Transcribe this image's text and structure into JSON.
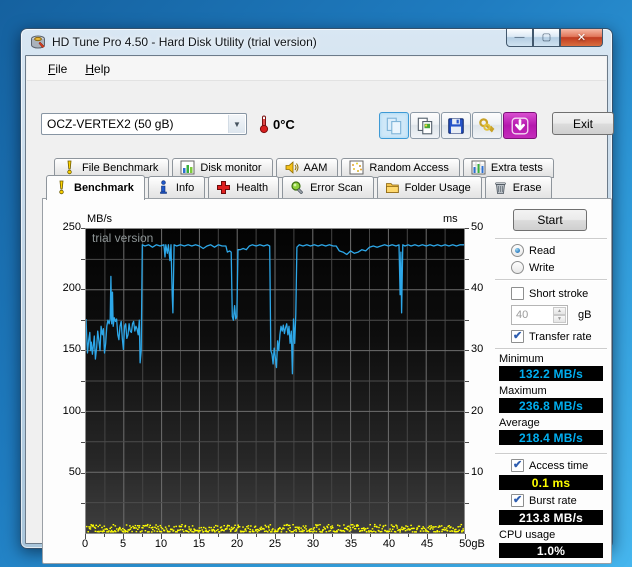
{
  "window": {
    "title": "HD Tune Pro 4.50 - Hard Disk Utility (trial version)",
    "controls": {
      "minimize": "—",
      "maximize": "▢",
      "close": "✕"
    }
  },
  "menu": {
    "items": [
      "File",
      "Help"
    ]
  },
  "toolbar": {
    "drive_select": "OCZ-VERTEX2 (50 gB)",
    "temperature": "0°C",
    "buttons": [
      {
        "icon": "copy-pages",
        "active": true
      },
      {
        "icon": "copy-screenshot",
        "active": false
      },
      {
        "icon": "save-screenshot",
        "active": false
      },
      {
        "icon": "license-keys",
        "active": false
      },
      {
        "icon": "download-arrow",
        "active": false,
        "accent": true
      }
    ],
    "exit_label": "Exit"
  },
  "tabs": {
    "row1": [
      {
        "label": "File Benchmark",
        "icon": "exclamation"
      },
      {
        "label": "Disk monitor",
        "icon": "bar-chart"
      },
      {
        "label": "AAM",
        "icon": "speaker"
      },
      {
        "label": "Random Access",
        "icon": "scatter"
      },
      {
        "label": "Extra tests",
        "icon": "chart-grid"
      }
    ],
    "row2": [
      {
        "label": "Benchmark",
        "icon": "exclamation",
        "active": true
      },
      {
        "label": "Info",
        "icon": "info"
      },
      {
        "label": "Health",
        "icon": "health-cross"
      },
      {
        "label": "Error Scan",
        "icon": "magnifier"
      },
      {
        "label": "Folder Usage",
        "icon": "folder"
      },
      {
        "label": "Erase",
        "icon": "trash"
      }
    ]
  },
  "panel": {
    "start_label": "Start",
    "mode": {
      "read_label": "Read",
      "write_label": "Write",
      "selected": "Read"
    },
    "short_stroke": {
      "label": "Short stroke",
      "checked": false,
      "value": "40",
      "unit": "gB"
    },
    "transfer_rate": {
      "label": "Transfer rate",
      "checked": true
    },
    "stats": {
      "minimum_label": "Minimum",
      "minimum": "132.2 MB/s",
      "maximum_label": "Maximum",
      "maximum": "236.8 MB/s",
      "average_label": "Average",
      "average": "218.4 MB/s"
    },
    "access_time": {
      "label": "Access time",
      "checked": true,
      "value": "0.1 ms"
    },
    "burst_rate": {
      "label": "Burst rate",
      "checked": true,
      "value": "213.8 MB/s"
    },
    "cpu_usage": {
      "label": "CPU usage",
      "value": "1.0%"
    }
  },
  "chart_data": {
    "type": "line",
    "watermark": "trial version",
    "left_axis": {
      "label": "MB/s",
      "min": 0,
      "max": 250,
      "ticks": [
        250,
        200,
        150,
        100,
        50
      ],
      "grid_step": 25
    },
    "right_axis": {
      "label": "ms",
      "min": 0,
      "max": 50,
      "ticks": [
        50,
        40,
        30,
        20,
        10
      ]
    },
    "x_axis": {
      "min": 0,
      "max": 50,
      "tick_labels": [
        "0",
        "5",
        "10",
        "15",
        "20",
        "25",
        "30",
        "35",
        "40",
        "45",
        "50gB"
      ],
      "tick_step": 5,
      "minor_step": 2.5
    },
    "series": [
      {
        "name": "transfer-rate",
        "axis": "left",
        "unit": "MB/s",
        "color": "#2da7e8",
        "style": "line",
        "points": [
          [
            0,
            176
          ],
          [
            0.1,
            160
          ],
          [
            0.2,
            148
          ],
          [
            0.35,
            158
          ],
          [
            0.5,
            165
          ],
          [
            0.6,
            150
          ],
          [
            0.7,
            157
          ],
          [
            0.85,
            147
          ],
          [
            1.0,
            156
          ],
          [
            1.1,
            162
          ],
          [
            1.25,
            143
          ],
          [
            1.4,
            152
          ],
          [
            1.55,
            166
          ],
          [
            1.7,
            158
          ],
          [
            1.85,
            150
          ],
          [
            2.0,
            170
          ],
          [
            2.15,
            163
          ],
          [
            2.3,
            168
          ],
          [
            2.45,
            148
          ],
          [
            2.6,
            156
          ],
          [
            2.75,
            170
          ],
          [
            2.9,
            175
          ],
          [
            3.05,
            172
          ],
          [
            3.2,
            176
          ],
          [
            3.3,
            211
          ],
          [
            3.4,
            172
          ],
          [
            3.5,
            198
          ],
          [
            3.6,
            170
          ],
          [
            3.75,
            177
          ],
          [
            3.9,
            174
          ],
          [
            4.05,
            176
          ],
          [
            4.2,
            163
          ],
          [
            4.35,
            159
          ],
          [
            4.5,
            170
          ],
          [
            4.65,
            174
          ],
          [
            4.8,
            160
          ],
          [
            4.95,
            151
          ],
          [
            5.1,
            170
          ],
          [
            5.25,
            172
          ],
          [
            5.4,
            160
          ],
          [
            5.55,
            163
          ],
          [
            5.7,
            172
          ],
          [
            5.85,
            166
          ],
          [
            6.0,
            165
          ],
          [
            6.15,
            172
          ],
          [
            6.3,
            174
          ],
          [
            6.45,
            166
          ],
          [
            6.6,
            170
          ],
          [
            6.75,
            168
          ],
          [
            6.9,
            163
          ],
          [
            7.05,
            175
          ],
          [
            7.15,
            140
          ],
          [
            7.3,
            150
          ],
          [
            7.45,
            237
          ],
          [
            7.8,
            236
          ],
          [
            8.3,
            237
          ],
          [
            8.8,
            235
          ],
          [
            9.3,
            237
          ],
          [
            9.8,
            236
          ],
          [
            10.3,
            237
          ],
          [
            10.45,
            227
          ],
          [
            10.55,
            237
          ],
          [
            10.75,
            230
          ],
          [
            10.9,
            237
          ],
          [
            11.1,
            224
          ],
          [
            11.25,
            237
          ],
          [
            11.4,
            196
          ],
          [
            11.5,
            181
          ],
          [
            11.65,
            237
          ],
          [
            12,
            236
          ],
          [
            12.5,
            237
          ],
          [
            13,
            236
          ],
          [
            13.5,
            237
          ],
          [
            14,
            236
          ],
          [
            14.5,
            237
          ],
          [
            15,
            236
          ],
          [
            15.5,
            234
          ],
          [
            16,
            236
          ],
          [
            16.5,
            237
          ],
          [
            17,
            235
          ],
          [
            17.5,
            237
          ],
          [
            18,
            236
          ],
          [
            18.5,
            236
          ],
          [
            18.7,
            231
          ],
          [
            19.0,
            232
          ],
          [
            19.2,
            231
          ],
          [
            19.35,
            178
          ],
          [
            19.5,
            175
          ],
          [
            19.65,
            187
          ],
          [
            19.8,
            176
          ],
          [
            19.95,
            178
          ],
          [
            20.1,
            233
          ],
          [
            20.4,
            233
          ],
          [
            20.8,
            234
          ],
          [
            21.2,
            233
          ],
          [
            21.6,
            236
          ],
          [
            22,
            237
          ],
          [
            22.5,
            236
          ],
          [
            23,
            237
          ],
          [
            23.5,
            236
          ],
          [
            24,
            237
          ],
          [
            24.3,
            236
          ],
          [
            24.45,
            150
          ],
          [
            24.6,
            147
          ],
          [
            24.75,
            139
          ],
          [
            24.9,
            152
          ],
          [
            25.05,
            144
          ],
          [
            25.2,
            136
          ],
          [
            25.35,
            158
          ],
          [
            25.5,
            150
          ],
          [
            25.65,
            163
          ],
          [
            25.8,
            170
          ],
          [
            25.95,
            166
          ],
          [
            26.1,
            171
          ],
          [
            26.25,
            164
          ],
          [
            26.4,
            169
          ],
          [
            26.55,
            172
          ],
          [
            26.7,
            163
          ],
          [
            26.85,
            170
          ],
          [
            27.0,
            156
          ],
          [
            27.15,
            166
          ],
          [
            27.3,
            131
          ],
          [
            27.45,
            176
          ],
          [
            27.6,
            156
          ],
          [
            27.75,
            180
          ],
          [
            27.9,
            235
          ],
          [
            28.2,
            237
          ],
          [
            28.7,
            236
          ],
          [
            29.2,
            237
          ],
          [
            29.7,
            236
          ],
          [
            30.2,
            237
          ],
          [
            30.7,
            236
          ],
          [
            31.2,
            237
          ],
          [
            31.7,
            236
          ],
          [
            32.2,
            237
          ],
          [
            32.7,
            236
          ],
          [
            33.1,
            236
          ],
          [
            33.5,
            232
          ],
          [
            34,
            231
          ],
          [
            34.5,
            229
          ],
          [
            35,
            232
          ],
          [
            35.5,
            230
          ],
          [
            36,
            231
          ],
          [
            36.5,
            233
          ],
          [
            37,
            232
          ],
          [
            37.5,
            235
          ],
          [
            38,
            236
          ],
          [
            38.5,
            235
          ],
          [
            39,
            236
          ],
          [
            39.5,
            237
          ],
          [
            40,
            236
          ],
          [
            40.5,
            237
          ],
          [
            41,
            236
          ],
          [
            41.4,
            237
          ],
          [
            41.55,
            196
          ],
          [
            41.65,
            231
          ],
          [
            41.75,
            181
          ],
          [
            41.9,
            237
          ],
          [
            42.2,
            236
          ],
          [
            42.6,
            237
          ],
          [
            43,
            236
          ],
          [
            43.5,
            237
          ],
          [
            44,
            236
          ],
          [
            44.5,
            237
          ],
          [
            45,
            236
          ],
          [
            45.5,
            237
          ],
          [
            46,
            236
          ],
          [
            46.5,
            237
          ],
          [
            47,
            236
          ],
          [
            47.5,
            237
          ],
          [
            48,
            236
          ],
          [
            48.5,
            237
          ],
          [
            49,
            236
          ],
          [
            49.5,
            237
          ],
          [
            50,
            237
          ]
        ]
      },
      {
        "name": "access-time",
        "axis": "right",
        "unit": "ms",
        "color": "#ffff00",
        "style": "dots",
        "value_ms": 0.1,
        "dot_count": 520,
        "y_min_ms": 0.3,
        "y_max_ms": 1.5
      }
    ]
  }
}
